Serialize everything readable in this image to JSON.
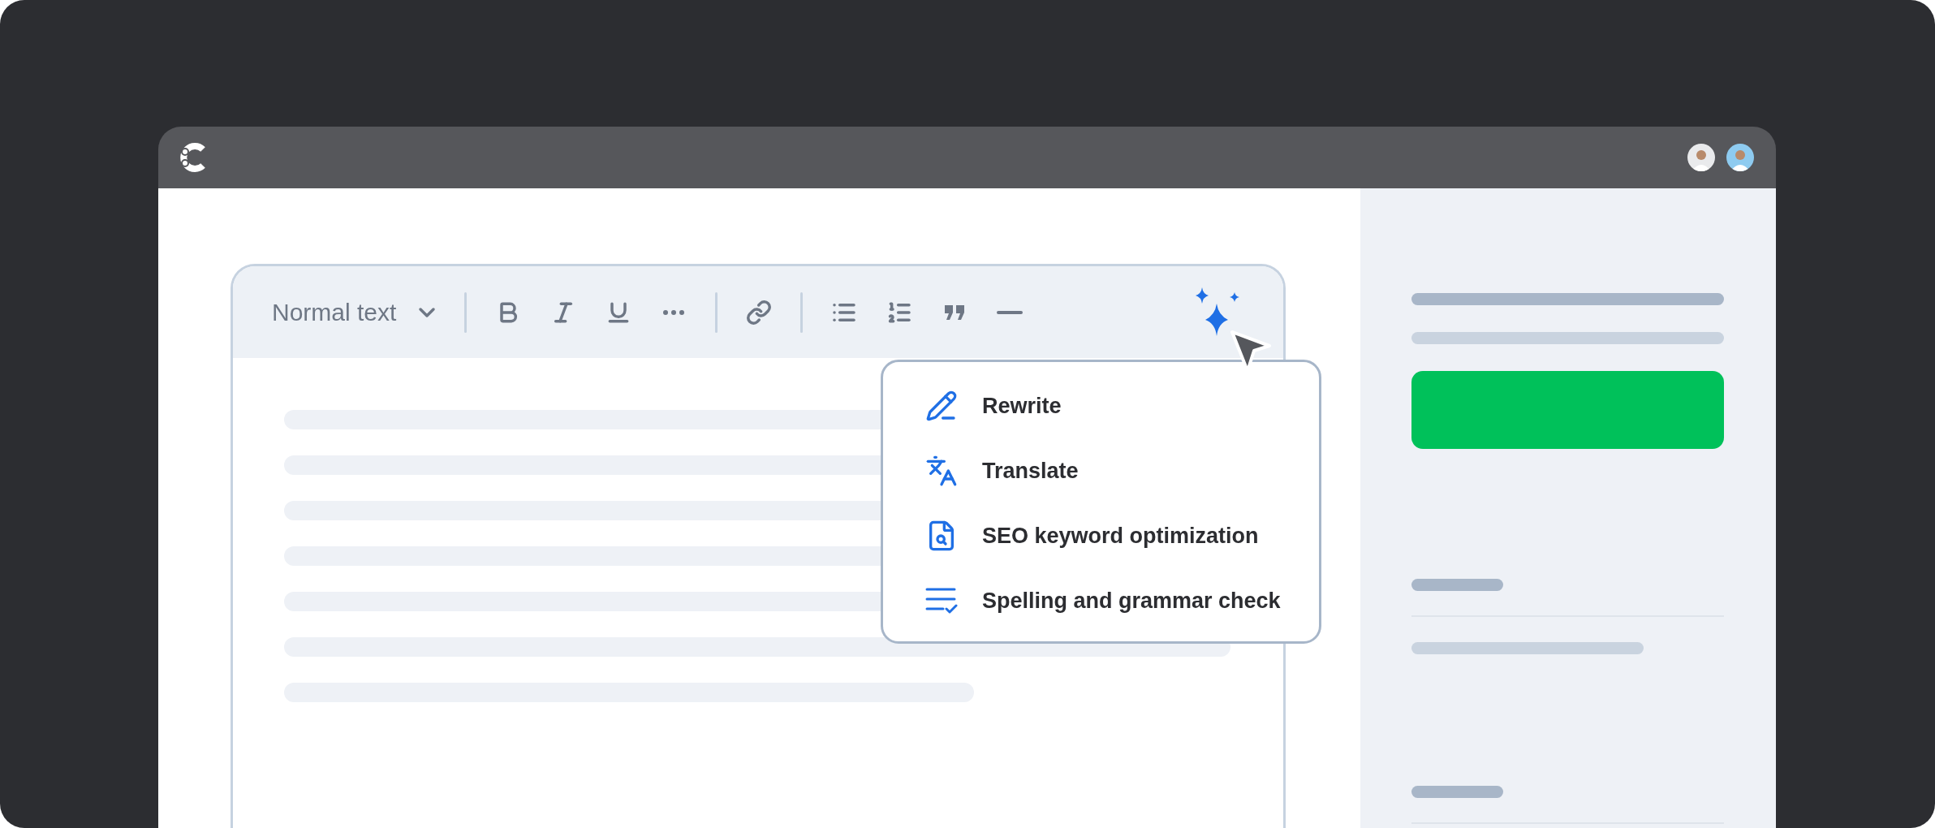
{
  "titlebar": {
    "avatars": [
      {
        "color": "#e9eaec"
      },
      {
        "color": "#8ecbf0"
      }
    ]
  },
  "toolbar": {
    "style_dropdown": "Normal text",
    "groups": [
      [
        {
          "kind": "bold"
        },
        {
          "kind": "italic"
        },
        {
          "kind": "underline"
        },
        {
          "kind": "more"
        }
      ],
      [
        {
          "kind": "link"
        }
      ],
      [
        {
          "kind": "bullet-list"
        },
        {
          "kind": "numbered-list"
        },
        {
          "kind": "quote"
        },
        {
          "kind": "divider"
        }
      ]
    ],
    "ai_button": {
      "kind": "sparkle"
    }
  },
  "ai_menu": {
    "items": [
      {
        "kind": "rewrite",
        "label": "Rewrite"
      },
      {
        "kind": "translate",
        "label": "Translate"
      },
      {
        "kind": "seo",
        "label": "SEO keyword optimization"
      },
      {
        "kind": "spelling",
        "label": "Spelling and grammar check"
      }
    ]
  }
}
